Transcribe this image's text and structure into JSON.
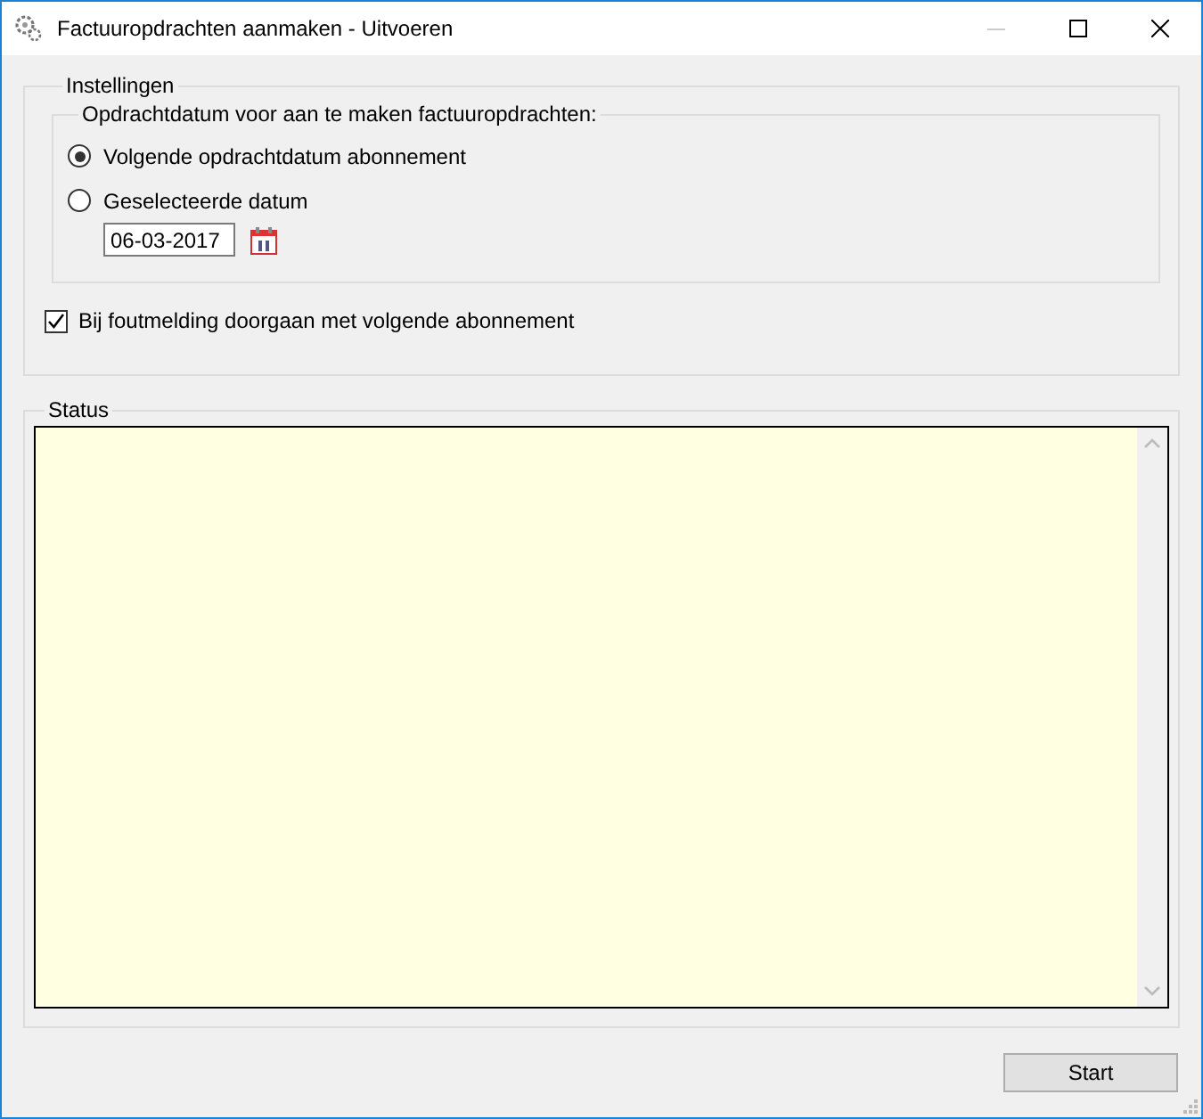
{
  "window": {
    "title": "Factuuropdrachten aanmaken - Uitvoeren",
    "controls": [
      {
        "kind": "minimize",
        "disabled": true
      },
      {
        "kind": "maximize",
        "disabled": false
      },
      {
        "kind": "close",
        "disabled": false
      }
    ]
  },
  "settings": {
    "label": "Instellingen",
    "date_group": {
      "label": "Opdrachtdatum voor aan te maken factuuropdrachten:",
      "options": [
        {
          "label": "Volgende opdrachtdatum abonnement",
          "selected": true
        },
        {
          "label": "Geselecteerde datum",
          "selected": false
        }
      ],
      "date_field": {
        "value": "06-03-2017"
      }
    },
    "continue_on_error": {
      "label": "Bij foutmelding doorgaan met volgende abonnement",
      "checked": true
    }
  },
  "status": {
    "label": "Status"
  },
  "buttons": [
    {
      "label": "Start"
    }
  ]
}
